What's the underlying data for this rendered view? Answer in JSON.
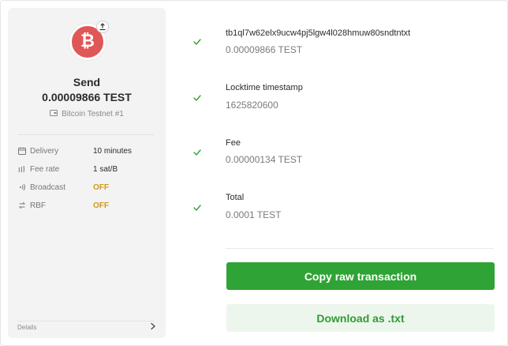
{
  "summary": {
    "coin_icon": "bitcoin-icon",
    "badge_icon": "send-arrow-icon",
    "title": "Send",
    "amount": "0.00009866 TEST",
    "account": "Bitcoin Testnet #1",
    "account_icon": "wallet-icon",
    "details": [
      {
        "icon": "calendar-icon",
        "label": "Delivery",
        "value": "10 minutes"
      },
      {
        "icon": "fee-icon",
        "label": "Fee rate",
        "value": "1 sat/B"
      },
      {
        "icon": "broadcast-icon",
        "label": "Broadcast",
        "value": "OFF"
      },
      {
        "icon": "rbf-icon",
        "label": "RBF",
        "value": "OFF"
      }
    ],
    "details_link": "Details"
  },
  "outputs": [
    {
      "label": "tb1ql7w62elx9ucw4pj5lgw4l028hmuw80sndtntxt",
      "value": "0.00009866 TEST"
    },
    {
      "label": "Locktime timestamp",
      "value": "1625820600"
    },
    {
      "label": "Fee",
      "value": "0.00000134 TEST"
    },
    {
      "label": "Total",
      "value": "0.0001 TEST"
    }
  ],
  "actions": {
    "copy_label": "Copy raw transaction",
    "download_label": "Download as .txt"
  },
  "colors": {
    "coin": "#e05757",
    "accent": "#2fa335",
    "warning": "#d0991d"
  }
}
